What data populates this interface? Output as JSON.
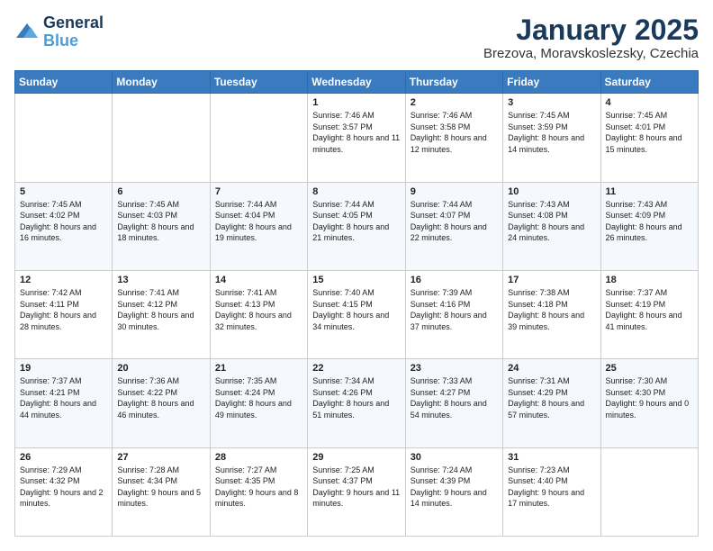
{
  "logo": {
    "line1": "General",
    "line2": "Blue"
  },
  "title": "January 2025",
  "subtitle": "Brezova, Moravskoslezsky, Czechia",
  "days_of_week": [
    "Sunday",
    "Monday",
    "Tuesday",
    "Wednesday",
    "Thursday",
    "Friday",
    "Saturday"
  ],
  "weeks": [
    [
      {
        "day": "",
        "sunrise": "",
        "sunset": "",
        "daylight": ""
      },
      {
        "day": "",
        "sunrise": "",
        "sunset": "",
        "daylight": ""
      },
      {
        "day": "",
        "sunrise": "",
        "sunset": "",
        "daylight": ""
      },
      {
        "day": "1",
        "sunrise": "Sunrise: 7:46 AM",
        "sunset": "Sunset: 3:57 PM",
        "daylight": "Daylight: 8 hours and 11 minutes."
      },
      {
        "day": "2",
        "sunrise": "Sunrise: 7:46 AM",
        "sunset": "Sunset: 3:58 PM",
        "daylight": "Daylight: 8 hours and 12 minutes."
      },
      {
        "day": "3",
        "sunrise": "Sunrise: 7:45 AM",
        "sunset": "Sunset: 3:59 PM",
        "daylight": "Daylight: 8 hours and 14 minutes."
      },
      {
        "day": "4",
        "sunrise": "Sunrise: 7:45 AM",
        "sunset": "Sunset: 4:01 PM",
        "daylight": "Daylight: 8 hours and 15 minutes."
      }
    ],
    [
      {
        "day": "5",
        "sunrise": "Sunrise: 7:45 AM",
        "sunset": "Sunset: 4:02 PM",
        "daylight": "Daylight: 8 hours and 16 minutes."
      },
      {
        "day": "6",
        "sunrise": "Sunrise: 7:45 AM",
        "sunset": "Sunset: 4:03 PM",
        "daylight": "Daylight: 8 hours and 18 minutes."
      },
      {
        "day": "7",
        "sunrise": "Sunrise: 7:44 AM",
        "sunset": "Sunset: 4:04 PM",
        "daylight": "Daylight: 8 hours and 19 minutes."
      },
      {
        "day": "8",
        "sunrise": "Sunrise: 7:44 AM",
        "sunset": "Sunset: 4:05 PM",
        "daylight": "Daylight: 8 hours and 21 minutes."
      },
      {
        "day": "9",
        "sunrise": "Sunrise: 7:44 AM",
        "sunset": "Sunset: 4:07 PM",
        "daylight": "Daylight: 8 hours and 22 minutes."
      },
      {
        "day": "10",
        "sunrise": "Sunrise: 7:43 AM",
        "sunset": "Sunset: 4:08 PM",
        "daylight": "Daylight: 8 hours and 24 minutes."
      },
      {
        "day": "11",
        "sunrise": "Sunrise: 7:43 AM",
        "sunset": "Sunset: 4:09 PM",
        "daylight": "Daylight: 8 hours and 26 minutes."
      }
    ],
    [
      {
        "day": "12",
        "sunrise": "Sunrise: 7:42 AM",
        "sunset": "Sunset: 4:11 PM",
        "daylight": "Daylight: 8 hours and 28 minutes."
      },
      {
        "day": "13",
        "sunrise": "Sunrise: 7:41 AM",
        "sunset": "Sunset: 4:12 PM",
        "daylight": "Daylight: 8 hours and 30 minutes."
      },
      {
        "day": "14",
        "sunrise": "Sunrise: 7:41 AM",
        "sunset": "Sunset: 4:13 PM",
        "daylight": "Daylight: 8 hours and 32 minutes."
      },
      {
        "day": "15",
        "sunrise": "Sunrise: 7:40 AM",
        "sunset": "Sunset: 4:15 PM",
        "daylight": "Daylight: 8 hours and 34 minutes."
      },
      {
        "day": "16",
        "sunrise": "Sunrise: 7:39 AM",
        "sunset": "Sunset: 4:16 PM",
        "daylight": "Daylight: 8 hours and 37 minutes."
      },
      {
        "day": "17",
        "sunrise": "Sunrise: 7:38 AM",
        "sunset": "Sunset: 4:18 PM",
        "daylight": "Daylight: 8 hours and 39 minutes."
      },
      {
        "day": "18",
        "sunrise": "Sunrise: 7:37 AM",
        "sunset": "Sunset: 4:19 PM",
        "daylight": "Daylight: 8 hours and 41 minutes."
      }
    ],
    [
      {
        "day": "19",
        "sunrise": "Sunrise: 7:37 AM",
        "sunset": "Sunset: 4:21 PM",
        "daylight": "Daylight: 8 hours and 44 minutes."
      },
      {
        "day": "20",
        "sunrise": "Sunrise: 7:36 AM",
        "sunset": "Sunset: 4:22 PM",
        "daylight": "Daylight: 8 hours and 46 minutes."
      },
      {
        "day": "21",
        "sunrise": "Sunrise: 7:35 AM",
        "sunset": "Sunset: 4:24 PM",
        "daylight": "Daylight: 8 hours and 49 minutes."
      },
      {
        "day": "22",
        "sunrise": "Sunrise: 7:34 AM",
        "sunset": "Sunset: 4:26 PM",
        "daylight": "Daylight: 8 hours and 51 minutes."
      },
      {
        "day": "23",
        "sunrise": "Sunrise: 7:33 AM",
        "sunset": "Sunset: 4:27 PM",
        "daylight": "Daylight: 8 hours and 54 minutes."
      },
      {
        "day": "24",
        "sunrise": "Sunrise: 7:31 AM",
        "sunset": "Sunset: 4:29 PM",
        "daylight": "Daylight: 8 hours and 57 minutes."
      },
      {
        "day": "25",
        "sunrise": "Sunrise: 7:30 AM",
        "sunset": "Sunset: 4:30 PM",
        "daylight": "Daylight: 9 hours and 0 minutes."
      }
    ],
    [
      {
        "day": "26",
        "sunrise": "Sunrise: 7:29 AM",
        "sunset": "Sunset: 4:32 PM",
        "daylight": "Daylight: 9 hours and 2 minutes."
      },
      {
        "day": "27",
        "sunrise": "Sunrise: 7:28 AM",
        "sunset": "Sunset: 4:34 PM",
        "daylight": "Daylight: 9 hours and 5 minutes."
      },
      {
        "day": "28",
        "sunrise": "Sunrise: 7:27 AM",
        "sunset": "Sunset: 4:35 PM",
        "daylight": "Daylight: 9 hours and 8 minutes."
      },
      {
        "day": "29",
        "sunrise": "Sunrise: 7:25 AM",
        "sunset": "Sunset: 4:37 PM",
        "daylight": "Daylight: 9 hours and 11 minutes."
      },
      {
        "day": "30",
        "sunrise": "Sunrise: 7:24 AM",
        "sunset": "Sunset: 4:39 PM",
        "daylight": "Daylight: 9 hours and 14 minutes."
      },
      {
        "day": "31",
        "sunrise": "Sunrise: 7:23 AM",
        "sunset": "Sunset: 4:40 PM",
        "daylight": "Daylight: 9 hours and 17 minutes."
      },
      {
        "day": "",
        "sunrise": "",
        "sunset": "",
        "daylight": ""
      }
    ]
  ]
}
